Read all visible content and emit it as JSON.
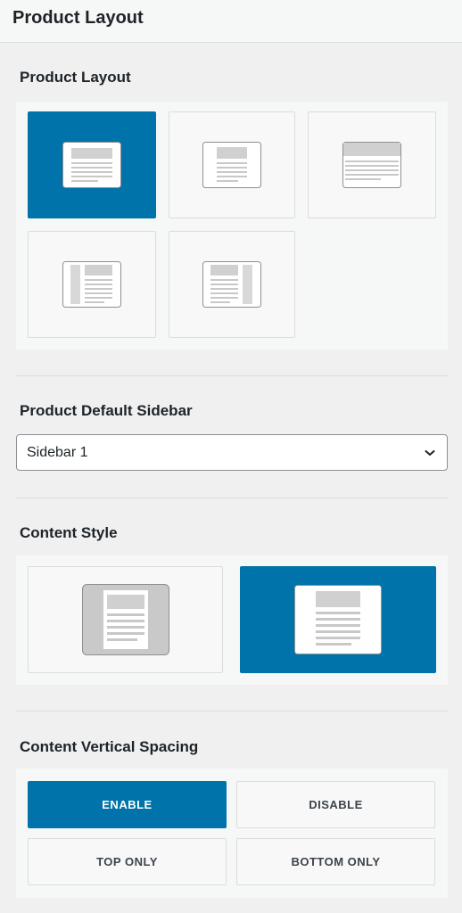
{
  "header": {
    "title": "Product Layout"
  },
  "product_layout": {
    "label": "Product Layout",
    "options": [
      {
        "name": "default-layout-icon",
        "active": true
      },
      {
        "name": "boxed-layout-icon",
        "active": false
      },
      {
        "name": "full-width-layout-icon",
        "active": false
      },
      {
        "name": "left-sidebar-layout-icon",
        "active": false
      },
      {
        "name": "right-sidebar-layout-icon",
        "active": false
      }
    ]
  },
  "sidebar": {
    "label": "Product Default Sidebar",
    "selected": "Sidebar 1"
  },
  "content_style": {
    "label": "Content Style",
    "options": [
      {
        "name": "boxed-content-icon",
        "active": false
      },
      {
        "name": "unboxed-content-icon",
        "active": true
      }
    ]
  },
  "vertical_spacing": {
    "label": "Content Vertical Spacing",
    "options": [
      {
        "label": "ENABLE",
        "active": true
      },
      {
        "label": "DISABLE",
        "active": false
      },
      {
        "label": "TOP ONLY",
        "active": false
      },
      {
        "label": "BOTTOM ONLY",
        "active": false
      }
    ]
  },
  "colors": {
    "accent": "#0073aa",
    "border": "#dcdcde",
    "background": "#f0f0f1"
  }
}
